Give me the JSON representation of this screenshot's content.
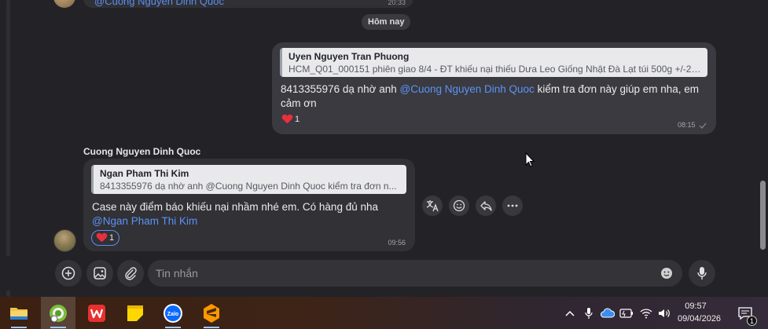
{
  "top_message": {
    "mention": "@Cuong Nguyen Dinh Quoc",
    "time": "20:33"
  },
  "date_divider": "Hôm nay",
  "outgoing_message": {
    "quote_name": "Uyen Nguyen Tran Phuong",
    "quote_text": "HCM_Q01_000151 phiên giao 8/4 - ĐT khiếu nại thiếu Dưa Leo Giống Nhật Đà Lạt túi 500g +/-20...",
    "text_before": "8413355976 dạ nhờ anh ",
    "mention": "@Cuong Nguyen Dinh Quoc",
    "text_after": " kiểm tra đơn này giúp em nha, em cảm ơn",
    "reaction_count": "1",
    "time": "08:15"
  },
  "incoming_message": {
    "sender": "Cuong Nguyen Dinh Quoc",
    "quote_name": "Ngan Pham Thi Kim",
    "quote_text": "8413355976 dạ nhờ anh @Cuong Nguyen Dinh Quoc kiểm tra đơn n...",
    "text": "Case này điểm báo khiếu nại nhầm nhé em. Có hàng đủ nha",
    "mention": "@Ngan Pham Thi Kim",
    "reaction_count": "1",
    "time": "09:56"
  },
  "message_actions": [
    "translate-icon",
    "emoji-react-icon",
    "reply-icon",
    "more-icon"
  ],
  "composer": {
    "placeholder": "Tin nhắn"
  },
  "taskbar": {
    "apps": [
      "file-explorer",
      "chrome-like",
      "wps-office",
      "sticky-notes",
      "zalo",
      "sublime-text"
    ],
    "zalo_label": "Zalo",
    "time": "09:57",
    "date": "09/04/2026",
    "notification_count": "1"
  },
  "colors": {
    "mention": "#5c93f5",
    "reaction_outline": "#5b8ff0",
    "heart": "#e8303d"
  }
}
